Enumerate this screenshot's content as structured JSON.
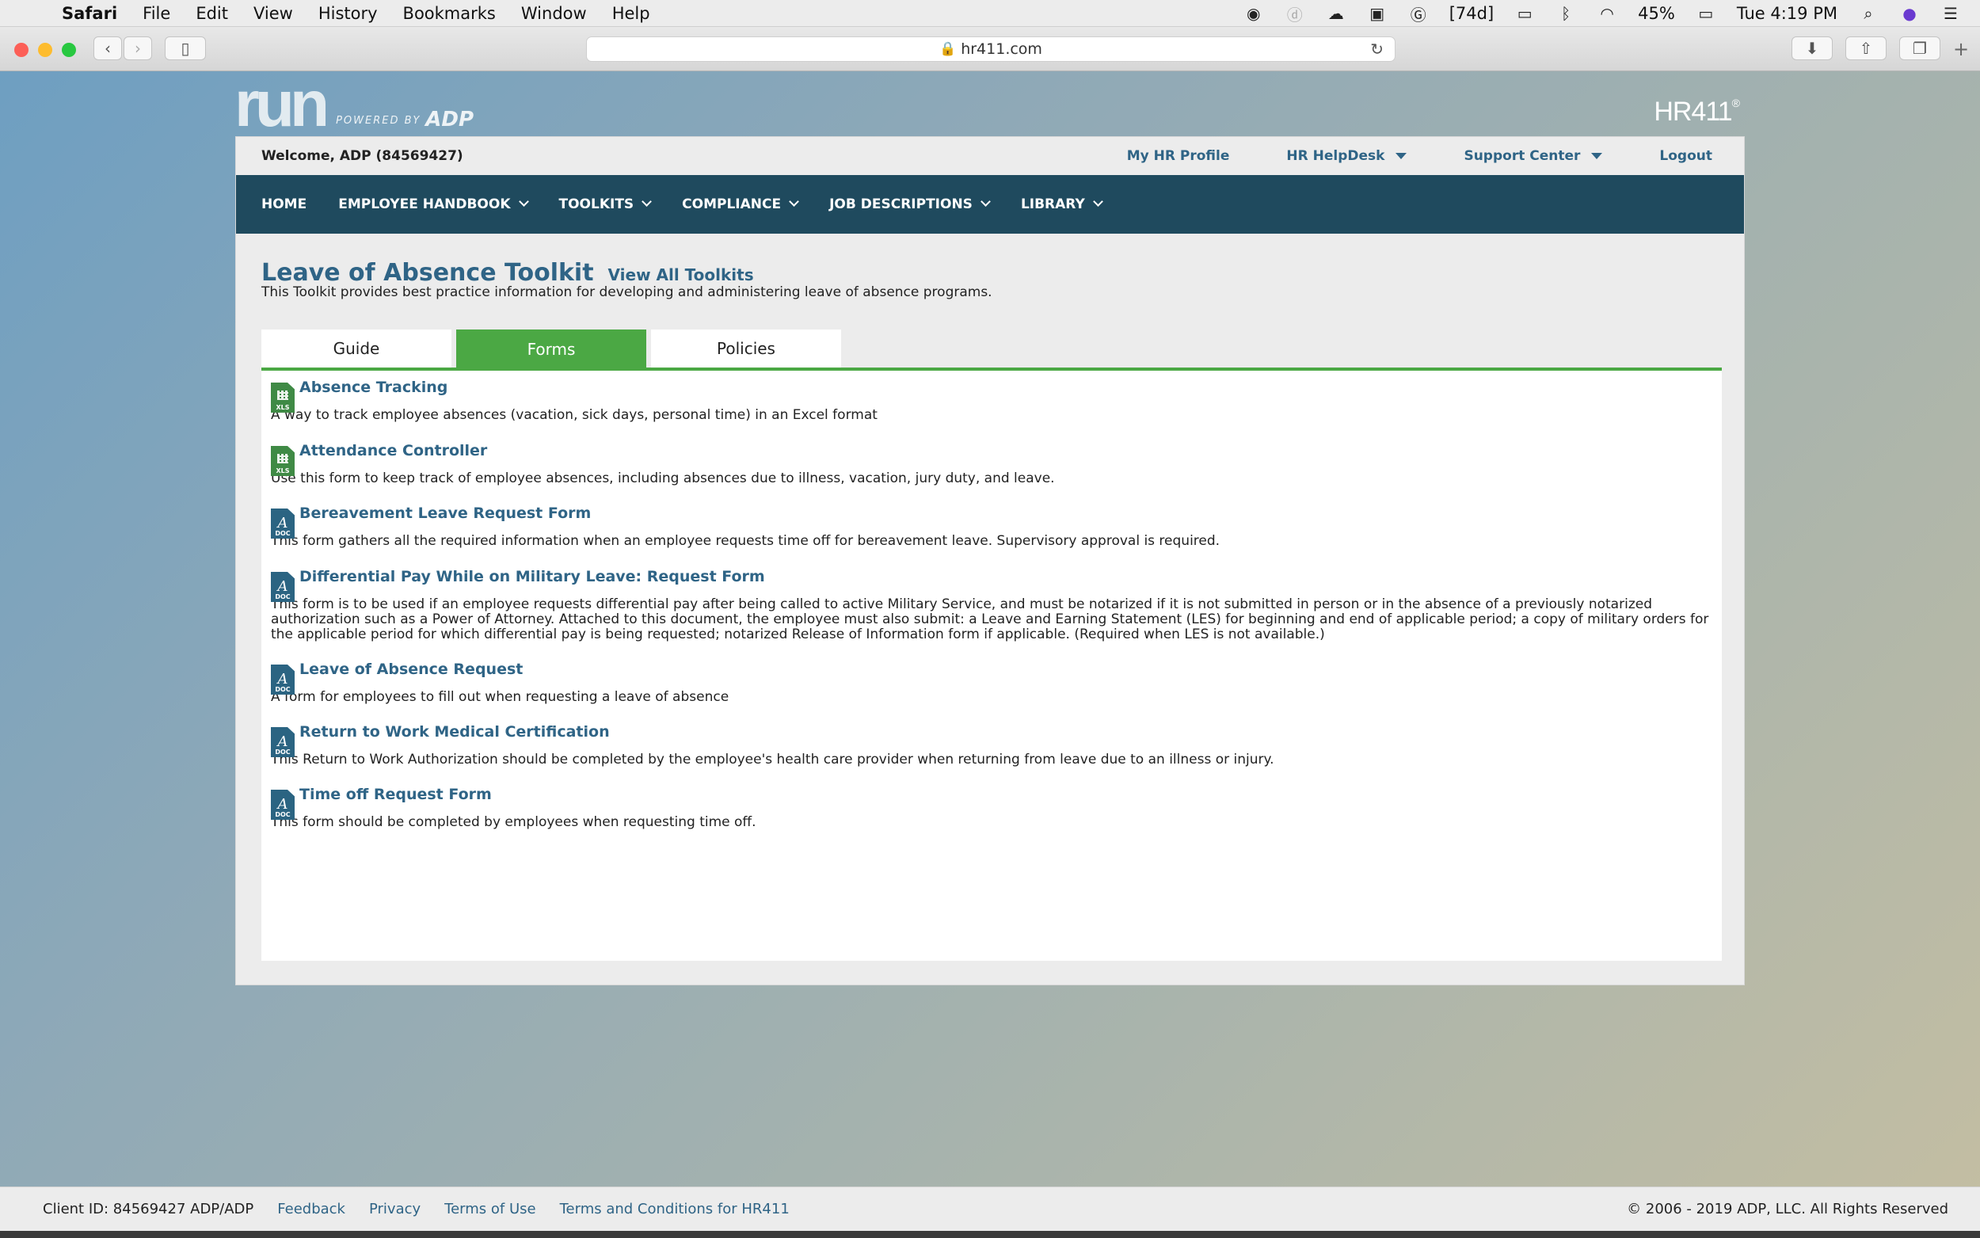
{
  "menubar": {
    "app": "Safari",
    "items": [
      "File",
      "Edit",
      "View",
      "History",
      "Bookmarks",
      "Window",
      "Help"
    ],
    "status_badge": "[74d]",
    "battery": "45%",
    "clock": "Tue 4:19 PM"
  },
  "browser": {
    "url": "hr411.com"
  },
  "brand": {
    "logo_text": "run",
    "powered_by": "POWERED BY",
    "adp": "ADP",
    "product": "HR411"
  },
  "topbar": {
    "welcome": "Welcome, ADP (84569427)",
    "my_profile": "My HR Profile",
    "helpdesk": "HR HelpDesk",
    "support": "Support Center",
    "logout": "Logout"
  },
  "nav": {
    "home": "HOME",
    "handbook": "EMPLOYEE HANDBOOK",
    "toolkits": "TOOLKITS",
    "compliance": "COMPLIANCE",
    "job_descriptions": "JOB DESCRIPTIONS",
    "library": "LIBRARY"
  },
  "page": {
    "title": "Leave of Absence Toolkit",
    "view_all": "View All Toolkits",
    "description": "This Toolkit provides best practice information for developing and administering leave of absence programs."
  },
  "tabs": {
    "guide": "Guide",
    "forms": "Forms",
    "policies": "Policies"
  },
  "forms": [
    {
      "type": "XLS",
      "name": "Absence Tracking",
      "desc": "A way to track employee absences (vacation, sick days, personal time) in an Excel format"
    },
    {
      "type": "XLS",
      "name": "Attendance Controller",
      "desc": "Use this form to keep track of employee absences, including absences due to illness, vacation, jury duty, and leave."
    },
    {
      "type": "DOC",
      "name": "Bereavement Leave Request Form",
      "desc": "This form gathers all the required information when an employee requests time off for bereavement leave. Supervisory approval is required."
    },
    {
      "type": "DOC",
      "name": "Differential Pay While on Military Leave: Request Form",
      "desc": "This form is to be used if an employee requests differential pay after being called to active Military Service, and must be notarized if it is not submitted in person or in the absence of a previously notarized authorization such as a Power of Attorney. Attached to this document, the employee must also submit: a Leave and Earning Statement (LES) for beginning and end of applicable period; a copy of military orders for the applicable period for which differential pay is being requested; notarized Release of Information form if applicable. (Required when LES is not available.)"
    },
    {
      "type": "DOC",
      "name": "Leave of Absence Request",
      "desc": "A form for employees to fill out when requesting a leave of absence"
    },
    {
      "type": "DOC",
      "name": "Return to Work Medical Certification",
      "desc": "This Return to Work Authorization should be completed by the employee's health care provider when returning from leave due to an illness or injury."
    },
    {
      "type": "DOC",
      "name": "Time off Request Form",
      "desc": "This form should be completed by employees when requesting time off."
    }
  ],
  "footer": {
    "client_id": "Client ID: 84569427 ADP/ADP",
    "feedback": "Feedback",
    "privacy": "Privacy",
    "terms": "Terms of Use",
    "terms_hr411": "Terms and Conditions for HR411",
    "copyright": "© 2006 - 2019 ADP, LLC. All Rights Reserved"
  }
}
